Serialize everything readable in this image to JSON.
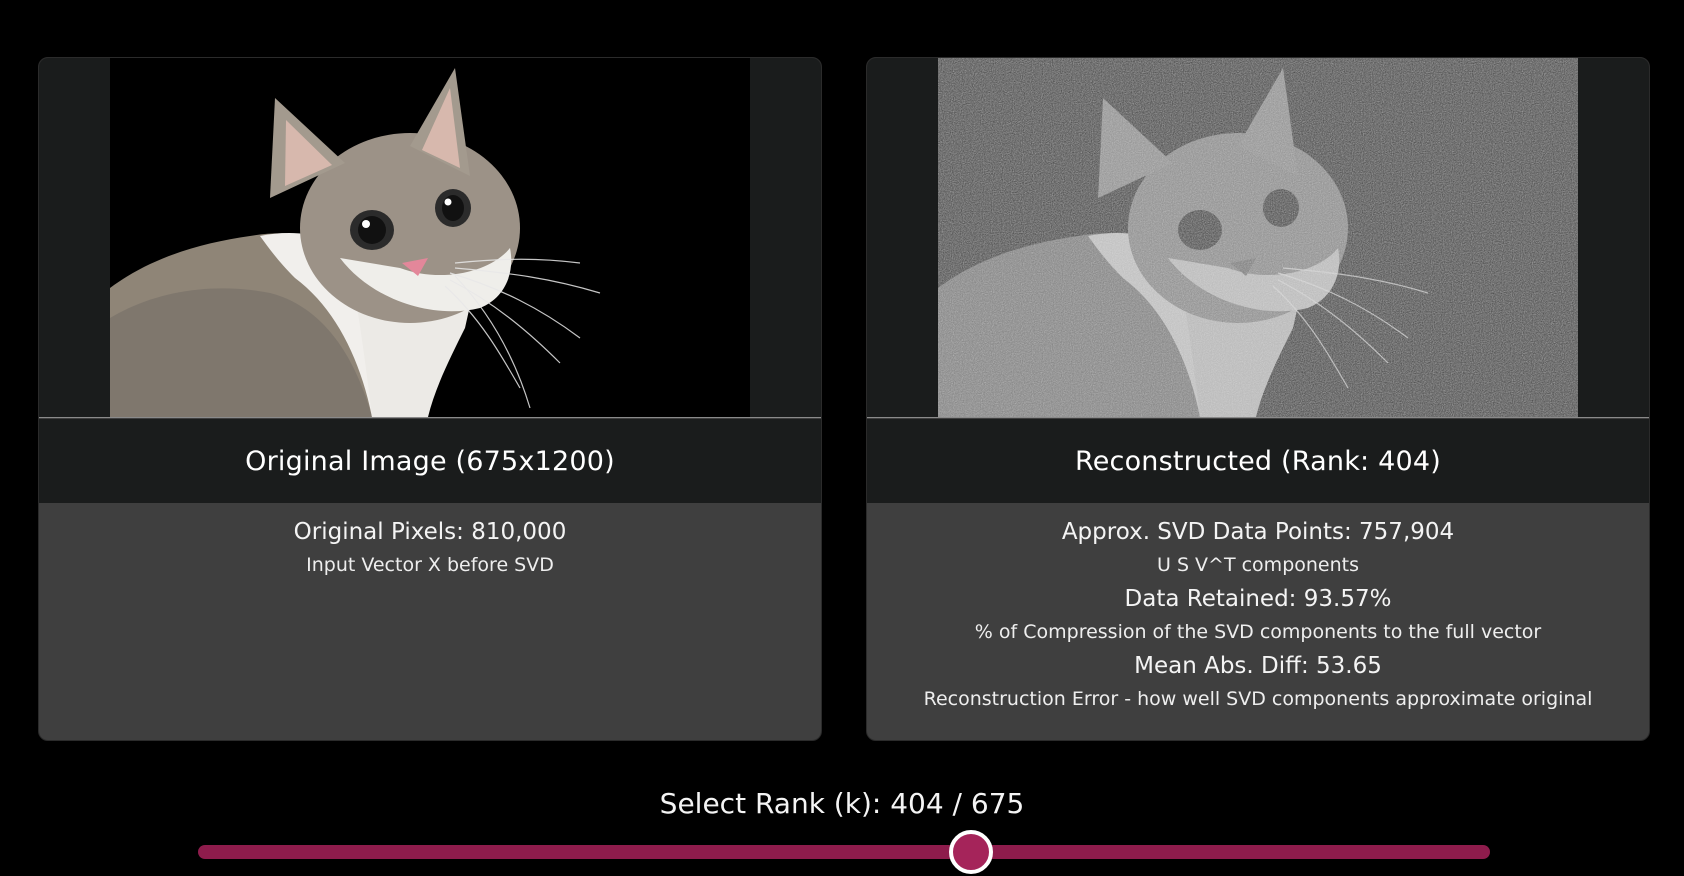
{
  "original_card": {
    "title": "Original Image (675x1200)",
    "pixels_text": "Original Pixels: 810,000",
    "pixels_caption": "Input Vector X before SVD"
  },
  "reconstructed_card": {
    "title": "Reconstructed (Rank: 404)",
    "data_points_text": "Approx. SVD Data Points: 757,904",
    "data_points_caption": "U S V^T components",
    "retained_text": "Data Retained: 93.57%",
    "retained_caption": "% of Compression of the SVD components to the full vector",
    "diff_text": "Mean Abs. Diff: 53.65",
    "diff_caption": "Reconstruction Error - how well SVD components approximate original"
  },
  "rank_control": {
    "label": "Select Rank (k): 404 / 675",
    "value": 404,
    "max": 675
  },
  "colors": {
    "accent": "#a5245a",
    "track": "#8e1c4c",
    "panel_dark": "#1a1c1c",
    "panel_gray": "#3f3f3f"
  }
}
